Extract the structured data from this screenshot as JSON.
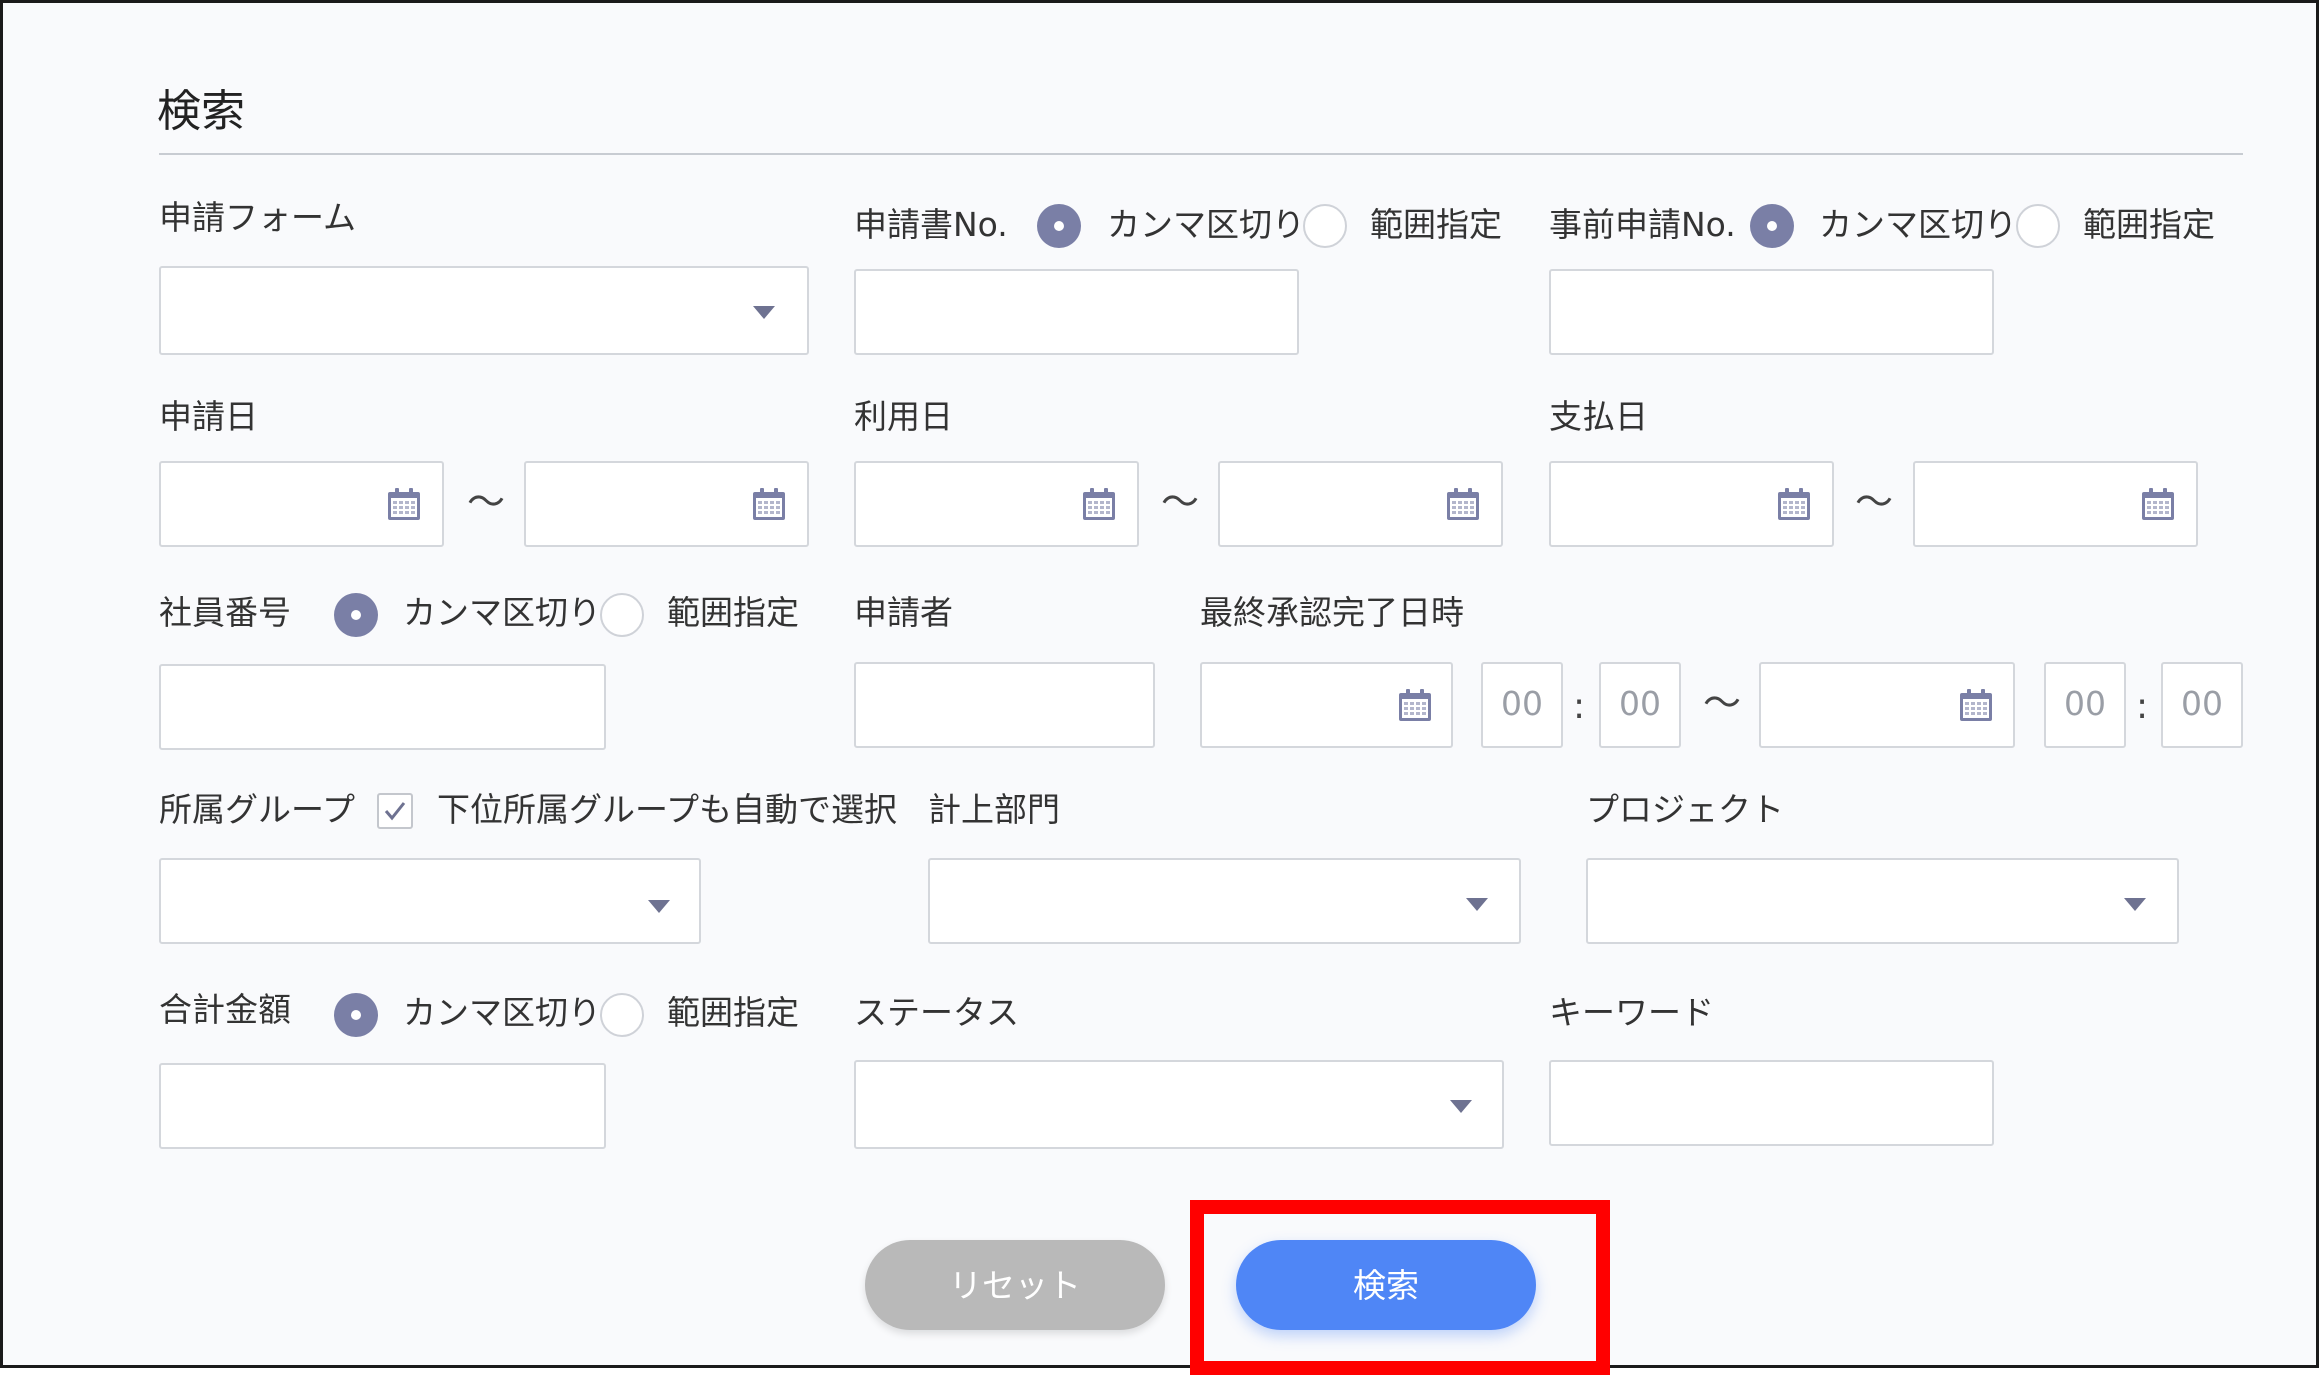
{
  "title": "検索",
  "option_labels": {
    "comma": "カンマ区切り",
    "range": "範囲指定"
  },
  "fields": {
    "form": {
      "label": "申請フォーム"
    },
    "app_no": {
      "label": "申請書No."
    },
    "pre_app_no": {
      "label": "事前申請No."
    },
    "apply_date": {
      "label": "申請日",
      "separator": "～"
    },
    "use_date": {
      "label": "利用日",
      "separator": "～"
    },
    "pay_date": {
      "label": "支払日",
      "separator": "～"
    },
    "employee_no": {
      "label": "社員番号"
    },
    "applicant": {
      "label": "申請者"
    },
    "final_approval": {
      "label": "最終承認完了日時",
      "separator": "～",
      "colon": ":",
      "hour_placeholder": "00",
      "minute_placeholder": "00"
    },
    "group": {
      "label": "所属グループ",
      "checkbox_label": "下位所属グループも自動で選択",
      "checkbox_checked": true
    },
    "dept": {
      "label": "計上部門"
    },
    "project": {
      "label": "プロジェクト"
    },
    "total": {
      "label": "合計金額"
    },
    "status": {
      "label": "ステータス"
    },
    "keyword": {
      "label": "キーワード"
    }
  },
  "buttons": {
    "reset": "リセット",
    "search": "検索"
  },
  "colors": {
    "accent": "#4f86f6",
    "radio_selected": "#7a7fa6",
    "reset_button": "#b9b9b9",
    "highlight": "#ff0000",
    "background": "#f9fafc"
  }
}
